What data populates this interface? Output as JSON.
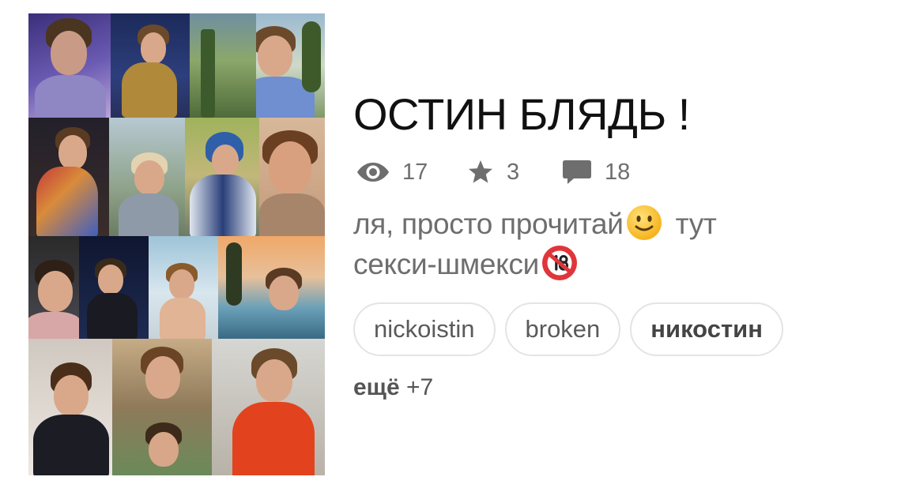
{
  "cover": {
    "alt": "collage of photos"
  },
  "story": {
    "title": "ОСТИН БЛЯДЬ !",
    "stats": {
      "views": "17",
      "stars": "3",
      "comments": "18"
    },
    "description_line1_a": "ля, просто прочитай",
    "description_line1_b": " тут",
    "description_line2": "секси-шмекси",
    "tags": [
      "nickoistin",
      "broken",
      "никостин"
    ],
    "more_label": "ещё",
    "more_count": "+7"
  },
  "icons": {
    "views": "eye-icon",
    "stars": "star-icon",
    "comments": "comment-bubble-icon",
    "smile": "slightly-smiling-face-emoji",
    "no18": "no-one-under-eighteen-emoji"
  },
  "colors": {
    "title": "#111111",
    "meta": "#6e6e6e",
    "tag_border": "#e4e4e4"
  }
}
